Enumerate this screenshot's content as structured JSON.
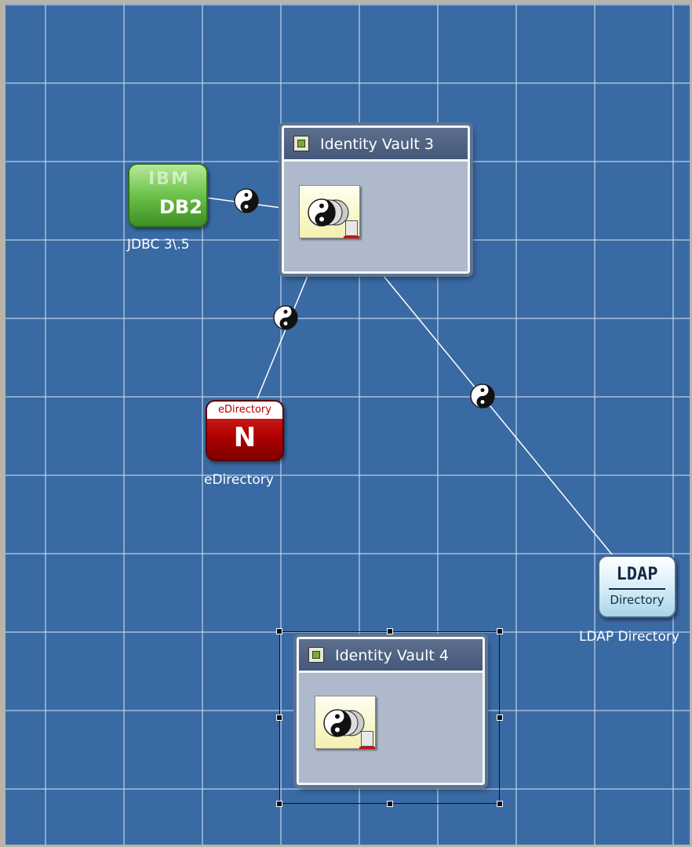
{
  "vaults": [
    {
      "title": "Identity Vault 3"
    },
    {
      "title": "Identity Vault 4"
    }
  ],
  "applications": {
    "db2": {
      "label": "JDBC 3\\.5",
      "icon_brand": "IBM",
      "icon_text": "DB2"
    },
    "edirectory": {
      "label": "eDirectory",
      "icon_banner": "eDirectory",
      "icon_letter": "N"
    },
    "ldap": {
      "label": "LDAP Directory",
      "icon_title": "LDAP",
      "icon_subtitle": "Directory"
    }
  },
  "icons": [
    "vault-badge-icon",
    "driverset-icon",
    "yin-yang-driver-icon",
    "ibm-db2-icon",
    "edirectory-icon",
    "ldap-directory-icon"
  ],
  "colors": {
    "canvas": "#3a6aa4",
    "vault_header": "#4e6283",
    "vault_body": "#aebacb",
    "db2": "#6cc24a",
    "edirectory": "#b00000",
    "ldap": "#d8eef8"
  }
}
